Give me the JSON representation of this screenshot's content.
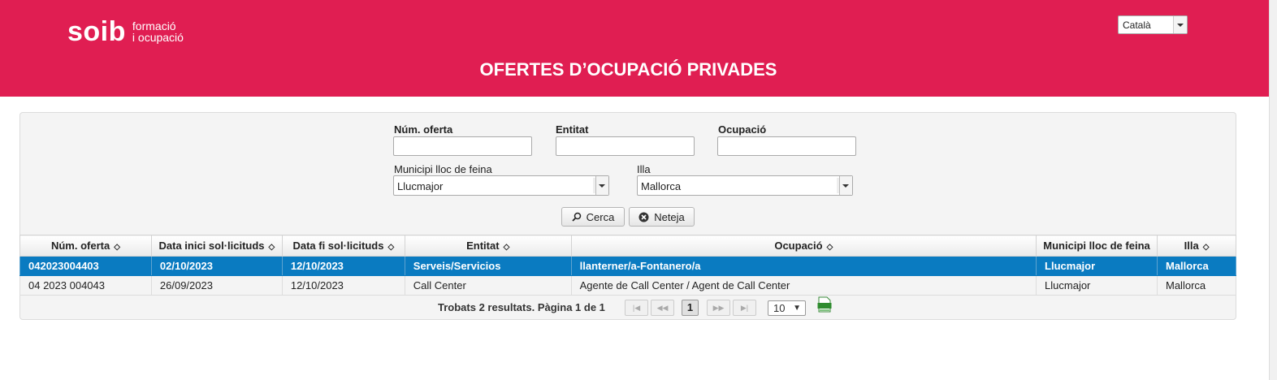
{
  "header": {
    "logo_main": "soib",
    "logo_sub_line1": "formació",
    "logo_sub_line2": "i ocupació",
    "language": "Català",
    "title": "OFERTES D’OCUPACIÓ PRIVADES",
    "brand_color": "#e01e52"
  },
  "filters": {
    "num_oferta_label": "Núm. oferta",
    "num_oferta_value": "",
    "entitat_label": "Entitat",
    "entitat_value": "",
    "ocupacio_label": "Ocupació",
    "ocupacio_value": "",
    "municipi_label": "Municipi lloc de feina",
    "municipi_value": "Llucmajor",
    "illa_label": "Illa",
    "illa_value": "Mallorca",
    "search_label": "Cerca",
    "clear_label": "Neteja"
  },
  "table": {
    "columns": [
      "Núm. oferta",
      "Data inici sol·licituds",
      "Data fi sol·licituds",
      "Entitat",
      "Ocupació",
      "Municipi lloc de feina",
      "Illa"
    ],
    "rows": [
      [
        "042023004403",
        "02/10/2023",
        "12/10/2023",
        "Serveis/Servicios",
        "llanterner/a-Fontanero/a",
        "Llucmajor",
        "Mallorca"
      ],
      [
        "04 2023 004043",
        "26/09/2023",
        "12/10/2023",
        "Call Center",
        "Agente de Call Center / Agent de Call Center",
        "Llucmajor",
        "Mallorca"
      ]
    ],
    "selected_color": "#0a7bc1"
  },
  "pager": {
    "summary": "Trobats 2 resultats. Pàgina 1 de 1",
    "current_page": "1",
    "rows_per_page": "10",
    "export_icon": "xls-export-icon"
  }
}
